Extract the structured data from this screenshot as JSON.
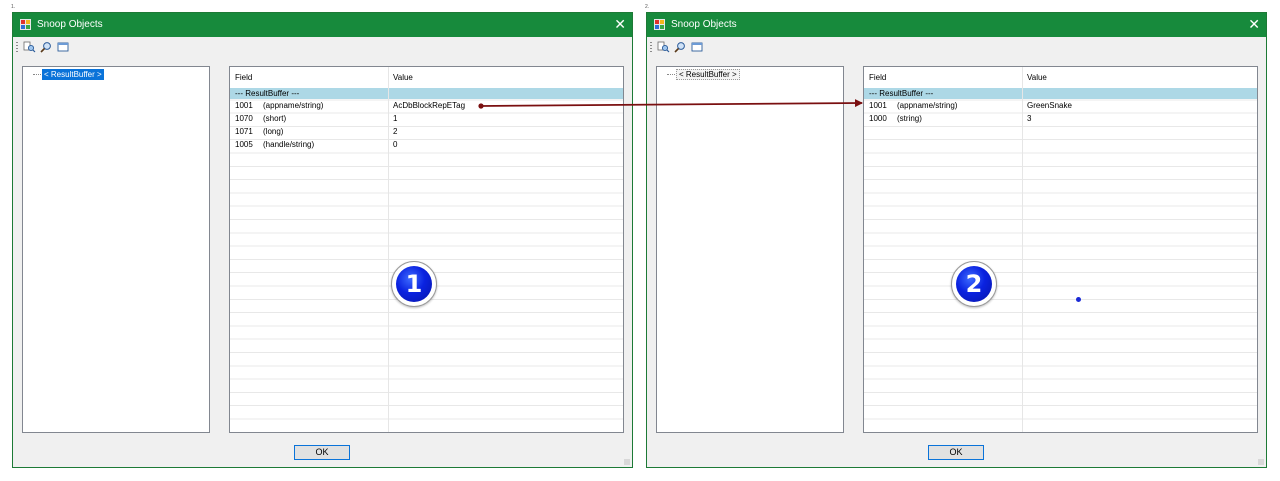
{
  "panel_labels": [
    "1.",
    "2."
  ],
  "colors": {
    "titlebar": "#178a3c",
    "selection": "#0a73d9",
    "group_row": "#add8e6",
    "arrow": "#7a0f10",
    "badge": "#0a22e0"
  },
  "windows": [
    {
      "title": "Snoop Objects",
      "toolbar_icons": [
        "snoop-icon",
        "find-icon",
        "window-icon"
      ],
      "tree": {
        "node_label": "< ResultBuffer >",
        "selected": true
      },
      "grid": {
        "columns": [
          "Field",
          "Value"
        ],
        "group": "--- ResultBuffer ---",
        "rows": [
          {
            "code": "1001",
            "type": "(appname/string)",
            "value": "AcDbBlockRepETag"
          },
          {
            "code": "1070",
            "type": "(short)",
            "value": "1"
          },
          {
            "code": "1071",
            "type": "(long)",
            "value": "2"
          },
          {
            "code": "1005",
            "type": "(handle/string)",
            "value": "0"
          }
        ]
      },
      "badge": "1",
      "ok_label": "OK"
    },
    {
      "title": "Snoop Objects",
      "toolbar_icons": [
        "snoop-icon",
        "find-icon",
        "window-icon"
      ],
      "tree": {
        "node_label": "< ResultBuffer >",
        "selected": false
      },
      "grid": {
        "columns": [
          "Field",
          "Value"
        ],
        "group": "--- ResultBuffer ---",
        "rows": [
          {
            "code": "1001",
            "type": "(appname/string)",
            "value": "GreenSnake"
          },
          {
            "code": "1000",
            "type": "(string)",
            "value": "3"
          }
        ]
      },
      "badge": "2",
      "ok_label": "OK"
    }
  ]
}
